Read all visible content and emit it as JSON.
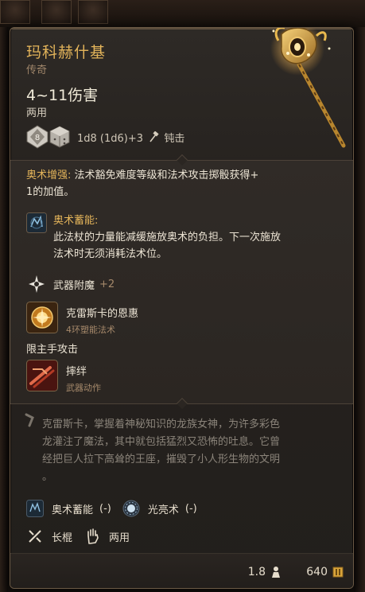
{
  "item": {
    "name": "玛科赫什基",
    "rarity": "传奇",
    "damage": "4~11伤害",
    "handedness": "两用",
    "die_value": "8",
    "damage_roll": "1d8 (1d6)+3",
    "damage_type": "钝击"
  },
  "description": {
    "boost_label": "奥术增强:",
    "boost_text": "法术豁免难度等级和法术攻击掷骰获得+",
    "boost_text2": "1的加值。"
  },
  "abilities": {
    "arcane": {
      "title": "奥术蓄能:",
      "line1": "此法杖的力量能减缓施放奥术的负担。下一次施放",
      "line2": "法术时无须消耗法术位。"
    },
    "enchant": {
      "label": "武器附魔",
      "value": "+2"
    },
    "spell": {
      "title": "克雷斯卡的恩惠",
      "sub": "4环塑能法术"
    },
    "mainhand_label": "限主手攻击",
    "action": {
      "title": "摔绊",
      "sub": "武器动作"
    }
  },
  "lore": {
    "line1": "克雷斯卡，掌握着神秘知识的龙族女神，为许多彩色",
    "line2": "龙灌注了魔法，其中就包括猛烈又恐怖的吐息。它曾",
    "line3": "经把巨人拉下高耸的王座，摧毁了小人形生物的文明",
    "line4": "。"
  },
  "properties": {
    "arcane_charge": "奥术蓄能",
    "arcane_charge_suffix": "(-)",
    "radiance": "光亮术",
    "radiance_suffix": "(-)",
    "weapon_type": "长棍",
    "hand_type": "两用"
  },
  "footer": {
    "weight": "1.8",
    "price": "640"
  },
  "colors": {
    "title_gold": "#e3b45a",
    "rarity_brown": "#a0866a",
    "lore_gray": "#8b847a"
  }
}
